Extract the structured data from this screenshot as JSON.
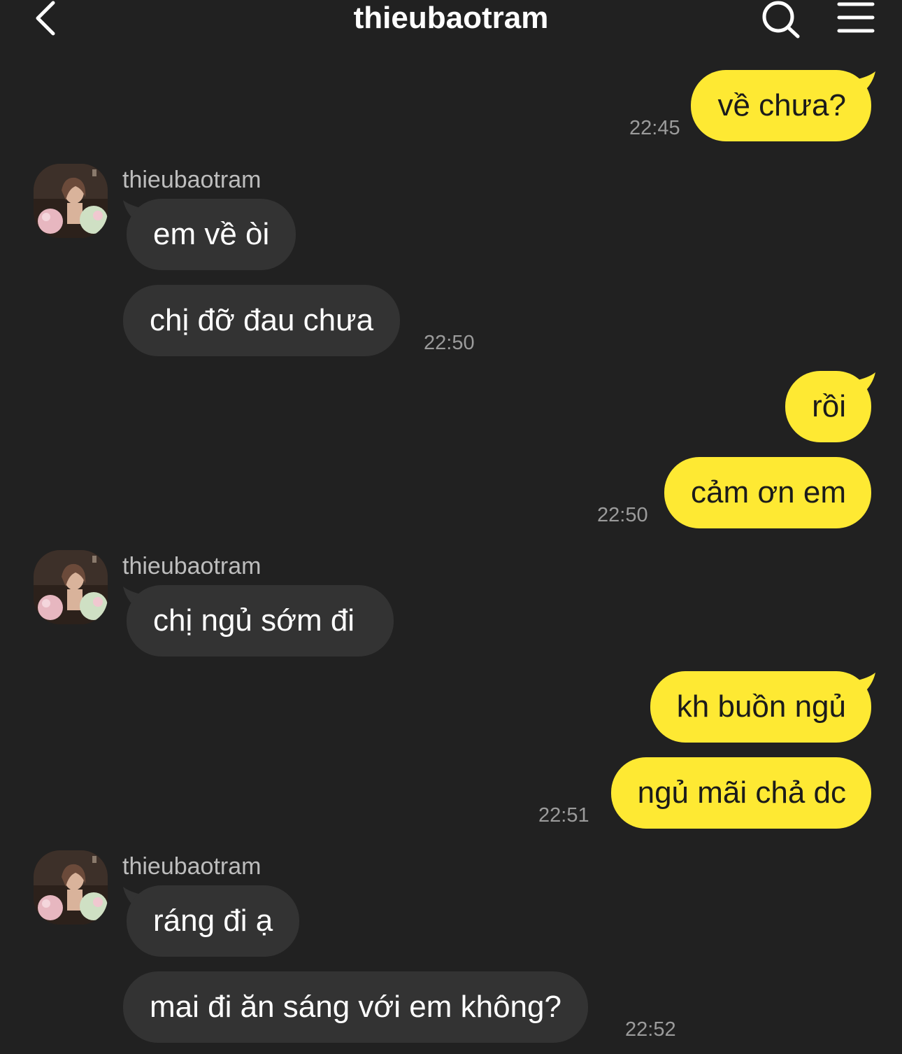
{
  "header": {
    "title": "thieubaotram",
    "back_icon": "chevron-left-icon",
    "search_icon": "search-icon",
    "menu_icon": "menu-icon"
  },
  "colors": {
    "background": "#212121",
    "my_bubble": "#fee933",
    "their_bubble": "#333333",
    "time_text": "#9b9b9b"
  },
  "messages": [
    {
      "from": "me",
      "text": "về chưa?",
      "time": "22:45"
    },
    {
      "from": "them",
      "sender": "thieubaotram",
      "text": "em về òi"
    },
    {
      "from": "them",
      "text": "chị đỡ đau chưa",
      "time": "22:50"
    },
    {
      "from": "me",
      "text": "rồi"
    },
    {
      "from": "me",
      "text": "cảm ơn em",
      "time": "22:50"
    },
    {
      "from": "them",
      "sender": "thieubaotram",
      "text": "chị ngủ sớm đi"
    },
    {
      "from": "me",
      "text": "kh buồn ngủ"
    },
    {
      "from": "me",
      "text": "ngủ mãi chả dc",
      "time": "22:51"
    },
    {
      "from": "them",
      "sender": "thieubaotram",
      "text": "ráng đi ạ"
    },
    {
      "from": "them",
      "text": "mai đi ăn sáng với em không?",
      "time": "22:52"
    }
  ]
}
